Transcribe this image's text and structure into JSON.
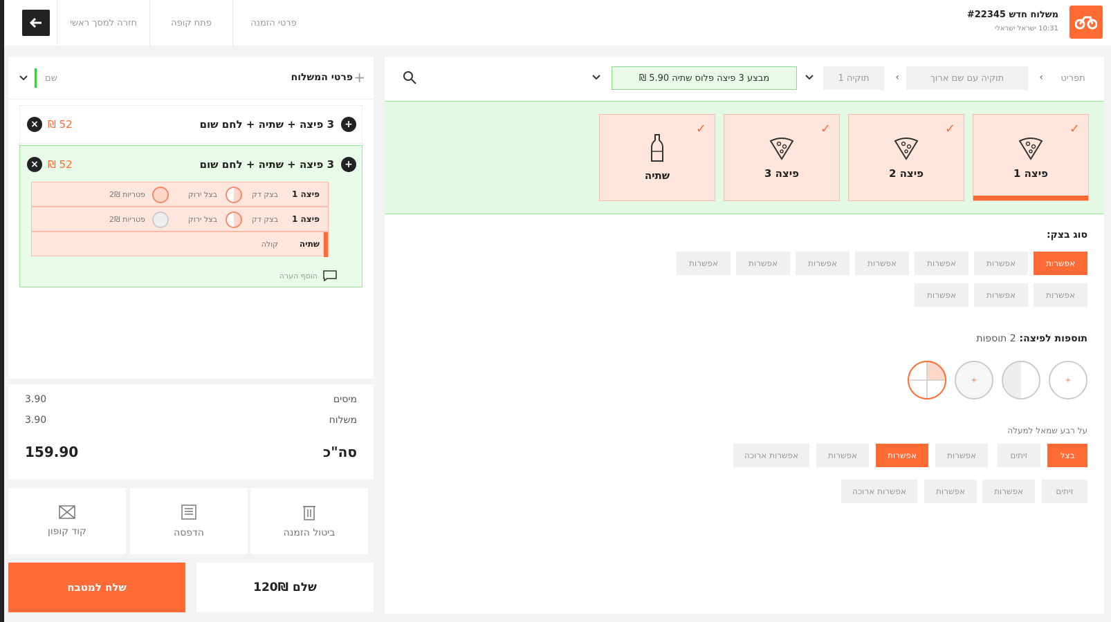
{
  "header": {
    "order_title": "משלוח חדש #22345",
    "order_sub": "10:31 ישראל ישראלי",
    "tabs": [
      "פרטי הזמנה",
      "פתח קופה",
      "חזרה למסך ראשי"
    ]
  },
  "order_panel": {
    "title": "פרטי המשלוח",
    "filter_value": "שם",
    "items": [
      {
        "name": "3 פיצה + שתיה + לחם שום",
        "price": "52 ₪"
      },
      {
        "name": "3 פיצה + שתיה + לחם שום",
        "price": "52 ₪"
      }
    ],
    "sub_rows": [
      {
        "label": "פיצה 1",
        "dough": "בצק דק",
        "topping": "בצל ירוק",
        "extra": "פטריות 2₪"
      },
      {
        "label": "פיצה 1",
        "dough": "בצק דק",
        "topping": "בצל ירוק",
        "extra": "פטריות 2₪"
      },
      {
        "label": "שתיה",
        "dough": "קולה"
      }
    ],
    "add_note": "הוסף הערה"
  },
  "totals": {
    "tax_label": "מיסים",
    "tax_value": "3.90",
    "delivery_label": "משלוח",
    "delivery_value": "3.90",
    "total_label": "סה\"כ",
    "total_value": "159.90"
  },
  "actions": {
    "cancel": "ביטול הזמנה",
    "print": "הדפסה",
    "coupon": "קוד קופון",
    "send": "שלח למטבח",
    "pay": "שלם 120₪"
  },
  "filters": {
    "menu": "תפריט",
    "category": "תוקיה עם שם ארוך",
    "sub": "תוקיה 1",
    "deal": "מבצע 3 פיצה פלוס שתיה 5.90 ₪"
  },
  "deal_cards": [
    "פיצה 1",
    "פיצה 2",
    "פיצה 3",
    "שתיה"
  ],
  "dough_section": {
    "title": "סוג בצק:",
    "chips_row1": [
      "אפשרות",
      "אפשרות",
      "אפשרות",
      "אפשרות",
      "אפשרות",
      "אפשרות",
      "אפשרות"
    ],
    "chips_row2": [
      "אפשרות",
      "אפשרות",
      "אפשרות"
    ]
  },
  "toppings_section": {
    "title": "תוספות לפיצה:",
    "count": "2 תוספות",
    "note": "על רבע שמאל למעלה",
    "row1": [
      "בצל",
      "זיתים",
      "אפשרות",
      "אפשרות",
      "אפשרות",
      "אפשרות ארוכה"
    ],
    "row2": [
      "זיתים",
      "אפשרות",
      "אפשרות",
      "אפשרות ארוכה"
    ]
  },
  "colors": {
    "accent": "#ff6b35",
    "green": "#3ec93e"
  }
}
